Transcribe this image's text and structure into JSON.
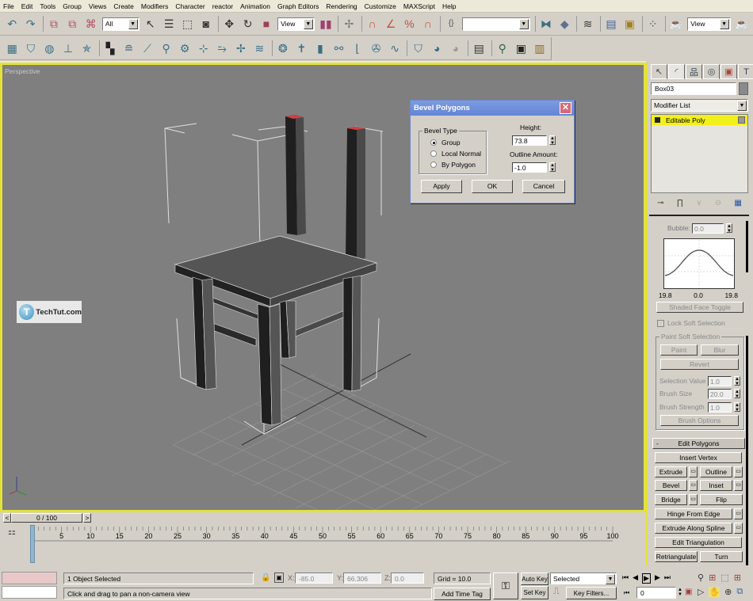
{
  "menu": [
    "File",
    "Edit",
    "Tools",
    "Group",
    "Views",
    "Create",
    "Modifiers",
    "Character",
    "reactor",
    "Animation",
    "Graph Editors",
    "Rendering",
    "Customize",
    "MAXScript",
    "Help"
  ],
  "main_toolbar": {
    "selection_filter": "All",
    "ref_coord": "View",
    "named_selection": "",
    "render_view": "View",
    "icons_left": [
      "undo-icon",
      "redo-icon",
      "select-link-icon",
      "unlink-icon",
      "bind-space-warp-icon"
    ],
    "icons_mid": [
      "select-object-icon",
      "select-by-name-icon",
      "rect-selection-icon",
      "window-crossing-icon",
      "move-icon",
      "rotate-icon",
      "scale-icon"
    ],
    "icons_right": [
      "use-pivot-icon",
      "manipulate-icon",
      "snap-3d-icon",
      "angle-snap-icon",
      "percent-snap-icon",
      "spinner-snap-icon",
      "edit-named-selection-icon",
      "mirror-icon",
      "align-icon",
      "layer-manager-icon",
      "curve-editor-icon",
      "schematic-view-icon",
      "material-editor-icon",
      "render-scene-icon",
      "quick-render-icon"
    ]
  },
  "tab_toolbar_icons": [
    "box-icon",
    "shirt-icon",
    "sphere-icon",
    "plane-icon",
    "star-icon",
    "checker-icon",
    "layers-icon",
    "bone-icon",
    "wrench-icon",
    "gear-icon",
    "space-warp-icon",
    "wind-icon",
    "fan-icon",
    "ripple-icon",
    "morph-icon",
    "biped-icon",
    "door-icon",
    "link-icon",
    "ik-icon",
    "wheel-icon",
    "wave-icon",
    "cloth-icon",
    "material-m-icon",
    "material-grey-icon",
    "panel-icon",
    "search-globe-icon",
    "render-frame-icon",
    "render-film-icon"
  ],
  "viewport": {
    "label": "Perspective",
    "watermark": "TechTut.com",
    "watermark_glyph": "T"
  },
  "dialog": {
    "title": "Bevel Polygons",
    "bevel_type_label": "Bevel Type",
    "options": [
      "Group",
      "Local Normal",
      "By Polygon"
    ],
    "selected_option": "Group",
    "height_label": "Height:",
    "height_value": "73.8",
    "outline_label": "Outline Amount:",
    "outline_value": "-1.0",
    "apply": "Apply",
    "ok": "OK",
    "cancel": "Cancel"
  },
  "command_panel": {
    "object_name": "Box03",
    "object_color": "#8a8a8a",
    "modifier_list": "Modifier List",
    "stack_item": "Editable Poly",
    "soft_selection": {
      "bubble_label": "Bubble:",
      "bubble_value": "0.0",
      "curve_labels": [
        "19.8",
        "0.0",
        "19.8"
      ],
      "shaded_face_toggle": "Shaded Face Toggle",
      "lock_soft_selection": "Lock Soft Selection",
      "paint_group": "Paint Soft Selection",
      "paint": "Paint",
      "blur": "Blur",
      "revert": "Revert",
      "selection_value_label": "Selection Value",
      "selection_value": "1.0",
      "brush_size_label": "Brush Size",
      "brush_size": "20.0",
      "brush_strength_label": "Brush Strength",
      "brush_strength": "1.0",
      "brush_options": "Brush Options"
    },
    "edit_polygons": {
      "title": "Edit Polygons",
      "collapse": "-",
      "insert_vertex": "Insert Vertex",
      "extrude": "Extrude",
      "outline": "Outline",
      "bevel": "Bevel",
      "inset": "Inset",
      "bridge": "Bridge",
      "flip": "Flip",
      "hinge_from_edge": "Hinge From Edge",
      "extrude_along_spline": "Extrude Along Spline",
      "edit_triangulation": "Edit Triangulation",
      "retriangulate": "Retriangulate",
      "turn": "Turn"
    }
  },
  "timeline": {
    "frame_display": "0 / 100",
    "prev": "<",
    "next": ">",
    "ticks": [
      "0",
      "5",
      "10",
      "15",
      "20",
      "25",
      "30",
      "35",
      "40",
      "45",
      "50",
      "55",
      "60",
      "65",
      "70",
      "75",
      "80",
      "85",
      "90",
      "95",
      "100"
    ],
    "current_frame": 0
  },
  "status": {
    "selection": "1 Object Selected",
    "prompt": "Click and drag to pan a non-camera view",
    "x_label": "X:",
    "x": "-85.0",
    "y_label": "Y:",
    "y": "66.306",
    "z_label": "Z:",
    "z": "0.0",
    "grid": "Grid = 10.0",
    "add_time_tag": "Add Time Tag",
    "auto_key": "Auto Key",
    "set_key": "Set Key",
    "key_mode": "Selected",
    "key_filters": "Key Filters...",
    "frame_field": "0"
  }
}
